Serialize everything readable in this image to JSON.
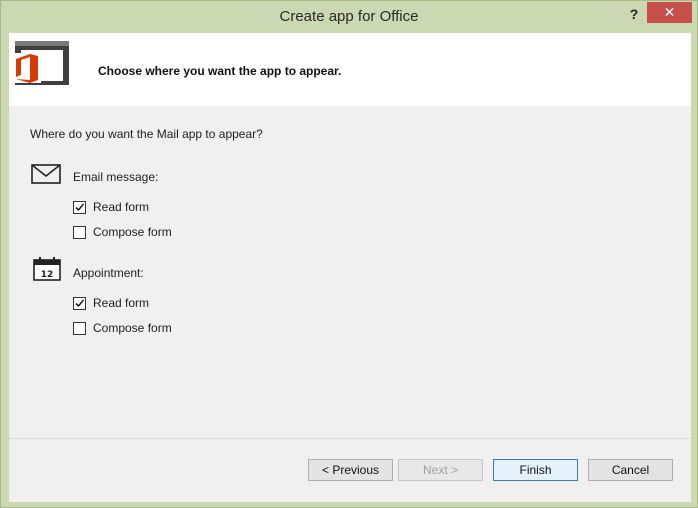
{
  "window": {
    "title": "Create app for Office",
    "help_label": "?",
    "close_label": "✕"
  },
  "header": {
    "instruction": "Choose where you want the app to appear.",
    "icon": "office-logo-icon",
    "accent": "#d83b01"
  },
  "question": "Where do you want the Mail app to appear?",
  "sections": [
    {
      "label": "Email message:",
      "icon": "envelope-icon",
      "options": [
        {
          "label": "Read form",
          "checked": true
        },
        {
          "label": "Compose form",
          "checked": false
        }
      ]
    },
    {
      "label": "Appointment:",
      "icon": "calendar-icon",
      "calendar_number": "12",
      "options": [
        {
          "label": "Read form",
          "checked": true
        },
        {
          "label": "Compose form",
          "checked": false
        }
      ]
    }
  ],
  "buttons": {
    "previous": "< Previous",
    "next": "Next >",
    "finish": "Finish",
    "cancel": "Cancel"
  }
}
